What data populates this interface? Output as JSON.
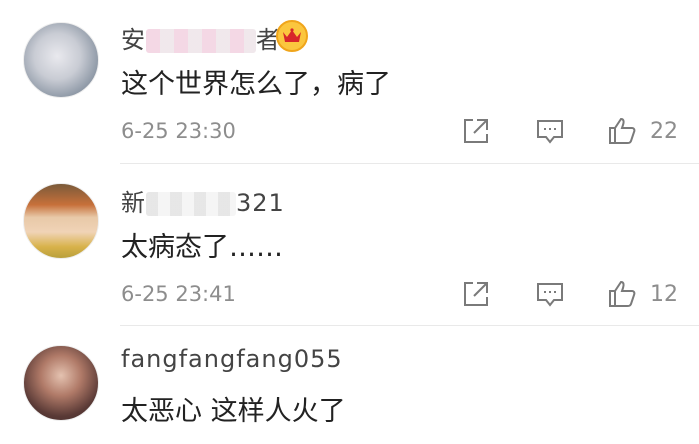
{
  "comments": [
    {
      "username_visible_start": "安",
      "username_visible_end": "者",
      "badge_icon": "crown-icon",
      "text": "这个世界怎么了，病了",
      "time": "6-25 23:30",
      "likes": "22"
    },
    {
      "username_visible_start": "新",
      "username_visible_end": "321",
      "text": "太病态了……",
      "time": "6-25 23:41",
      "likes": "12"
    },
    {
      "username_visible_start": "fangfangfang",
      "username_visible_end": "055",
      "text": "太恶心 这样人火了"
    }
  ],
  "colors": {
    "badge": "#fbc63e",
    "muted": "#8d8d8d",
    "divider": "#e9e9e9"
  }
}
